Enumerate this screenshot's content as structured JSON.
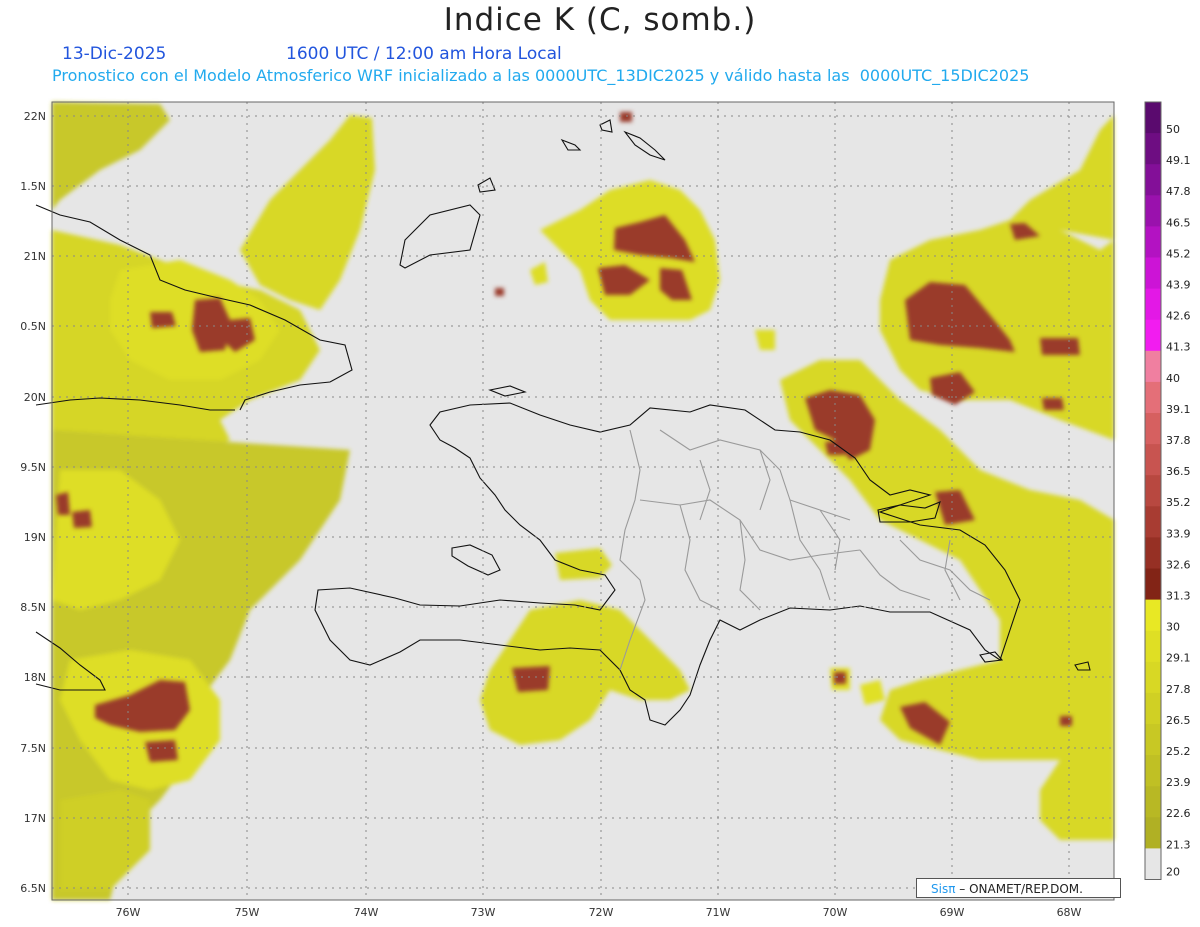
{
  "header": {
    "title": "Indice K (C, somb.)",
    "date": "13-Dic-2025",
    "time": "1600 UTC / 12:00 am Hora Local",
    "description": "Pronostico con el Modelo Atmosferico WRF inicializado a las 0000UTC_13DIC2025 y válido hasta las  0000UTC_15DIC2025"
  },
  "axes": {
    "lat_labels": [
      "22N",
      "1.5N",
      "21N",
      "0.5N",
      "20N",
      "9.5N",
      "19N",
      "8.5N",
      "18N",
      "7.5N",
      "17N",
      "6.5N"
    ],
    "lon_labels": [
      "76W",
      "75W",
      "74W",
      "73W",
      "72W",
      "71W",
      "70W",
      "69W",
      "68W"
    ]
  },
  "colorbar": {
    "values": [
      "50",
      "49.1",
      "47.8",
      "46.5",
      "45.2",
      "43.9",
      "42.6",
      "41.3",
      "40",
      "39.1",
      "37.8",
      "36.5",
      "35.2",
      "33.9",
      "32.6",
      "31.3",
      "30",
      "29.1",
      "27.8",
      "26.5",
      "25.2",
      "23.9",
      "22.6",
      "21.3",
      "20"
    ],
    "colors": [
      "#5a0a6e",
      "#6e0d82",
      "#830f98",
      "#9a11ad",
      "#b312c2",
      "#cc14d6",
      "#e318e6",
      "#f21cf0",
      "#f07fa0",
      "#e46f78",
      "#d66060",
      "#c85450",
      "#b84840",
      "#a83c32",
      "#963024",
      "#822416",
      "#e8e824",
      "#dfdf24",
      "#d8d824",
      "#d0d024",
      "#c8c824",
      "#c0c024",
      "#b8b824",
      "#b0b024",
      "#e6e6e6"
    ]
  },
  "credit": {
    "system": "Sisπ",
    "org": "– ONAMET/REP.DOM."
  }
}
